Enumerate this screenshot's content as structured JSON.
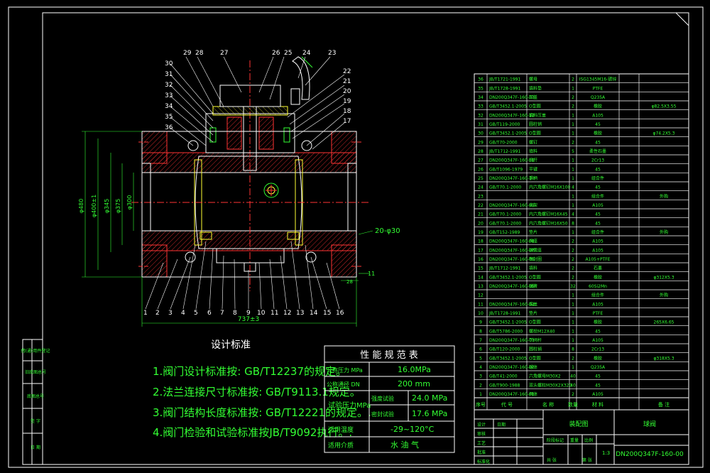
{
  "drawing": {
    "dimensions": {
      "d480": "φ480",
      "d400": "φ400±1",
      "d345": "φ345",
      "d375": "φ375",
      "d300": "φ300",
      "length": "737±3",
      "holes": "20-φ30",
      "d11": "11",
      "d28": "28"
    },
    "callouts_top": [
      "29",
      "28",
      "27",
      "26",
      "25",
      "24",
      "23"
    ],
    "callouts_left": [
      "30",
      "31",
      "32",
      "33",
      "34",
      "35",
      "36"
    ],
    "callouts_right": [
      "22",
      "21",
      "20",
      "19",
      "18",
      "17"
    ],
    "callouts_bottom": [
      "1",
      "2",
      "3",
      "4",
      "5",
      "6",
      "7",
      "8",
      "9",
      "10",
      "11",
      "12",
      "13",
      "14",
      "15",
      "16"
    ]
  },
  "design_standards": {
    "title": "设计标准",
    "lines": [
      "1.阀门设计标准按: GB/T12237的规定。",
      "2.法兰连接尺寸标准按: GB/T9113.1规定。",
      "3.阀门结构长度标准按: GB/T12221的规定。.",
      "4.阀门检验和试验标准按JB/T9092执行。."
    ]
  },
  "performance_table": {
    "title": "性 能 规 范 表",
    "rows": [
      {
        "label": "公称压力 MPa",
        "value": "16.0MPa"
      },
      {
        "label": "公称通径 DN",
        "value": "200 mm"
      },
      {
        "label": "试验压力MPa",
        "sub1": "强度试验",
        "val1": "24.0 MPa",
        "sub2": "密封试验",
        "val2": "17.6 MPa"
      },
      {
        "label": "适用温度",
        "value": "-29~120°C"
      },
      {
        "label": "适用介质",
        "value": "水 油 气"
      }
    ]
  },
  "parts_list": [
    {
      "no": "36",
      "code": "JB/T1721-1991",
      "name": "螺母",
      "qty": "2",
      "mat": "ISG1345M16-镀锌",
      "note": ""
    },
    {
      "no": "35",
      "code": "JB/T1728-1991",
      "name": "填料垫",
      "qty": "1",
      "mat": "PTFE",
      "note": ""
    },
    {
      "no": "34",
      "code": "DN200Q347F-160-13",
      "name": "压盖",
      "qty": "2",
      "mat": "Q235A",
      "note": ""
    },
    {
      "no": "33",
      "code": "GB/T3452.1-2005",
      "name": "O型圈",
      "qty": "2",
      "mat": "橡胶",
      "note": "φ82.5X3.55"
    },
    {
      "no": "32",
      "code": "DN200Q347F-160-12",
      "name": "填料压盖",
      "qty": "1",
      "mat": "A105",
      "note": ""
    },
    {
      "no": "31",
      "code": "GB/T119-2000",
      "name": "圆柱销",
      "qty": "1",
      "mat": "45",
      "note": ""
    },
    {
      "no": "30",
      "code": "GB/T3452.1-2005",
      "name": "O型圈",
      "qty": "1",
      "mat": "橡胶",
      "note": "φ74.2X5.3"
    },
    {
      "no": "29",
      "code": "GB/T70-2000",
      "name": "螺钉",
      "qty": "2",
      "mat": "45",
      "note": ""
    },
    {
      "no": "28",
      "code": "JB/T1712-1991",
      "name": "填料",
      "qty": "5",
      "mat": "柔性石墨",
      "note": ""
    },
    {
      "no": "27",
      "code": "DN200Q347F-160-11",
      "name": "阀杆",
      "qty": "1",
      "mat": "2Cr13",
      "note": ""
    },
    {
      "no": "26",
      "code": "GB/T1096-1979",
      "name": "平键",
      "qty": "1",
      "mat": "45",
      "note": ""
    },
    {
      "no": "25",
      "code": "DN200Q347F-160-10",
      "name": "手柄",
      "qty": "1",
      "mat": "组合件",
      "note": ""
    },
    {
      "no": "24",
      "code": "GB/T70.1-2000",
      "name": "内六角螺钉M16X100",
      "qty": "4",
      "mat": "45",
      "note": ""
    },
    {
      "no": "23",
      "code": "",
      "name": "",
      "qty": "1",
      "mat": "组合件",
      "note": "外购"
    },
    {
      "no": "22",
      "code": "DN200Q347F-160-09",
      "name": "支架",
      "qty": "1",
      "mat": "A105",
      "note": ""
    },
    {
      "no": "21",
      "code": "GB/T70.1-2000",
      "name": "内六角螺钉M16X45",
      "qty": "4",
      "mat": "45",
      "note": ""
    },
    {
      "no": "20",
      "code": "GB/T70.1-2000",
      "name": "内六角螺钉M16X50",
      "qty": "8",
      "mat": "45",
      "note": ""
    },
    {
      "no": "19",
      "code": "GB/T152-1989",
      "name": "垫片",
      "qty": "1",
      "mat": "组合件",
      "note": "外购"
    },
    {
      "no": "18",
      "code": "DN200Q347F-160-08",
      "name": "阀座",
      "qty": "2",
      "mat": "A105",
      "note": ""
    },
    {
      "no": "17",
      "code": "DN200Q347F-160-07",
      "name": "弹簧座",
      "qty": "2",
      "mat": "A105",
      "note": ""
    },
    {
      "no": "16",
      "code": "DN200Q347F-160-06",
      "name": "密封圈",
      "qty": "2",
      "mat": "A105+PTFE",
      "note": ""
    },
    {
      "no": "15",
      "code": "JB/T1712-1991",
      "name": "填料",
      "qty": "2",
      "mat": "石墨",
      "note": ""
    },
    {
      "no": "14",
      "code": "GB/T3452.1-2005",
      "name": "O型圈",
      "qty": "2",
      "mat": "橡胶",
      "note": "φ312X5.3"
    },
    {
      "no": "13",
      "code": "DN200Q347F-160-05",
      "name": "弹簧",
      "qty": "32",
      "mat": "60Si2Mn",
      "note": ""
    },
    {
      "no": "12",
      "code": "",
      "name": "",
      "qty": "1",
      "mat": "组合件",
      "note": "外购"
    },
    {
      "no": "11",
      "code": "DN200Q347F-160-04",
      "name": "底盖",
      "qty": "1",
      "mat": "A105",
      "note": ""
    },
    {
      "no": "10",
      "code": "JB/T1728-1991",
      "name": "垫片",
      "qty": "1",
      "mat": "PTFE",
      "note": ""
    },
    {
      "no": "9",
      "code": "GB/T3452.1-2005",
      "name": "O型圈",
      "qty": "1",
      "mat": "橡胶",
      "note": "265X6.65"
    },
    {
      "no": "8",
      "code": "GB/T5786-2000",
      "name": "螺栓M12X40",
      "qty": "1",
      "mat": "45",
      "note": ""
    },
    {
      "no": "7",
      "code": "DN200Q347F-160-03",
      "name": "下阀杆",
      "qty": "1",
      "mat": "A105",
      "note": ""
    },
    {
      "no": "6",
      "code": "GB/T120-2000",
      "name": "圆柱销",
      "qty": "8",
      "mat": "2Cr13",
      "note": ""
    },
    {
      "no": "5",
      "code": "GB/T3452.1-2005",
      "name": "O型圈",
      "qty": "2",
      "mat": "橡胶",
      "note": "φ318X5.3"
    },
    {
      "no": "4",
      "code": "DN200Q347F-160-02",
      "name": "球体",
      "qty": "1",
      "mat": "Q235A",
      "note": ""
    },
    {
      "no": "3",
      "code": "GB/T41-2000",
      "name": "六角螺母M30X2",
      "qty": "40",
      "mat": "45",
      "note": ""
    },
    {
      "no": "2",
      "code": "GB/T900-1988",
      "name": "双头螺柱M30X2X320",
      "qty": "40",
      "mat": "45",
      "note": ""
    },
    {
      "no": "1",
      "code": "DN200Q347F-160-01",
      "name": "阀体",
      "qty": "2",
      "mat": "A105",
      "note": ""
    }
  ],
  "parts_header": {
    "no": "序号",
    "code": "代 号",
    "name": "名 称",
    "qty": "数量",
    "mat": "材 料",
    "note": "备 注"
  },
  "title_block": {
    "title": "装配图",
    "company": "球阀",
    "drawing_no": "DN200Q347F-160-00",
    "scale": "1:3",
    "cells": [
      "设计",
      "审核",
      "工艺",
      "批准",
      "标准化",
      "日期",
      "阶段标记",
      "重量",
      "比例",
      "共 张",
      "第 张"
    ]
  },
  "left_strip": [
    "借(通)用件登记",
    "旧底图总号",
    "底图总号",
    "签 字",
    "日 期"
  ]
}
